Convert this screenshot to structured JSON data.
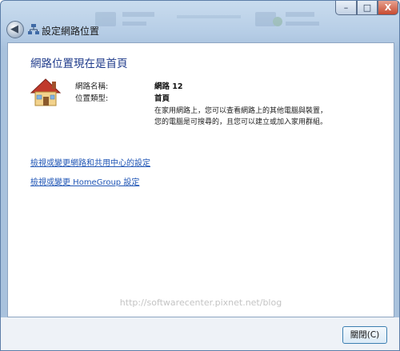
{
  "window": {
    "title": "設定網路位置",
    "min_glyph": "–",
    "max_glyph": "□",
    "close_glyph": "X",
    "back_glyph": "◀"
  },
  "main": {
    "heading": "網路位置現在是首頁",
    "network_name_label": "網路名稱:",
    "network_name_value": "網路  12",
    "location_type_label": "位置類型:",
    "location_type_value": "首頁",
    "description_line1": "在家用網路上，您可以查看網路上的其他電腦與裝置，",
    "description_line2": "您的電腦是可搜尋的，且您可以建立或加入家用群組。",
    "link_network_center": "檢視或變更網路和共用中心的設定",
    "link_homegroup": "檢視或變更 HomeGroup 設定"
  },
  "watermark": "http://softwarecenter.pixnet.net/blog",
  "footer": {
    "close_button": "關閉(C)"
  }
}
